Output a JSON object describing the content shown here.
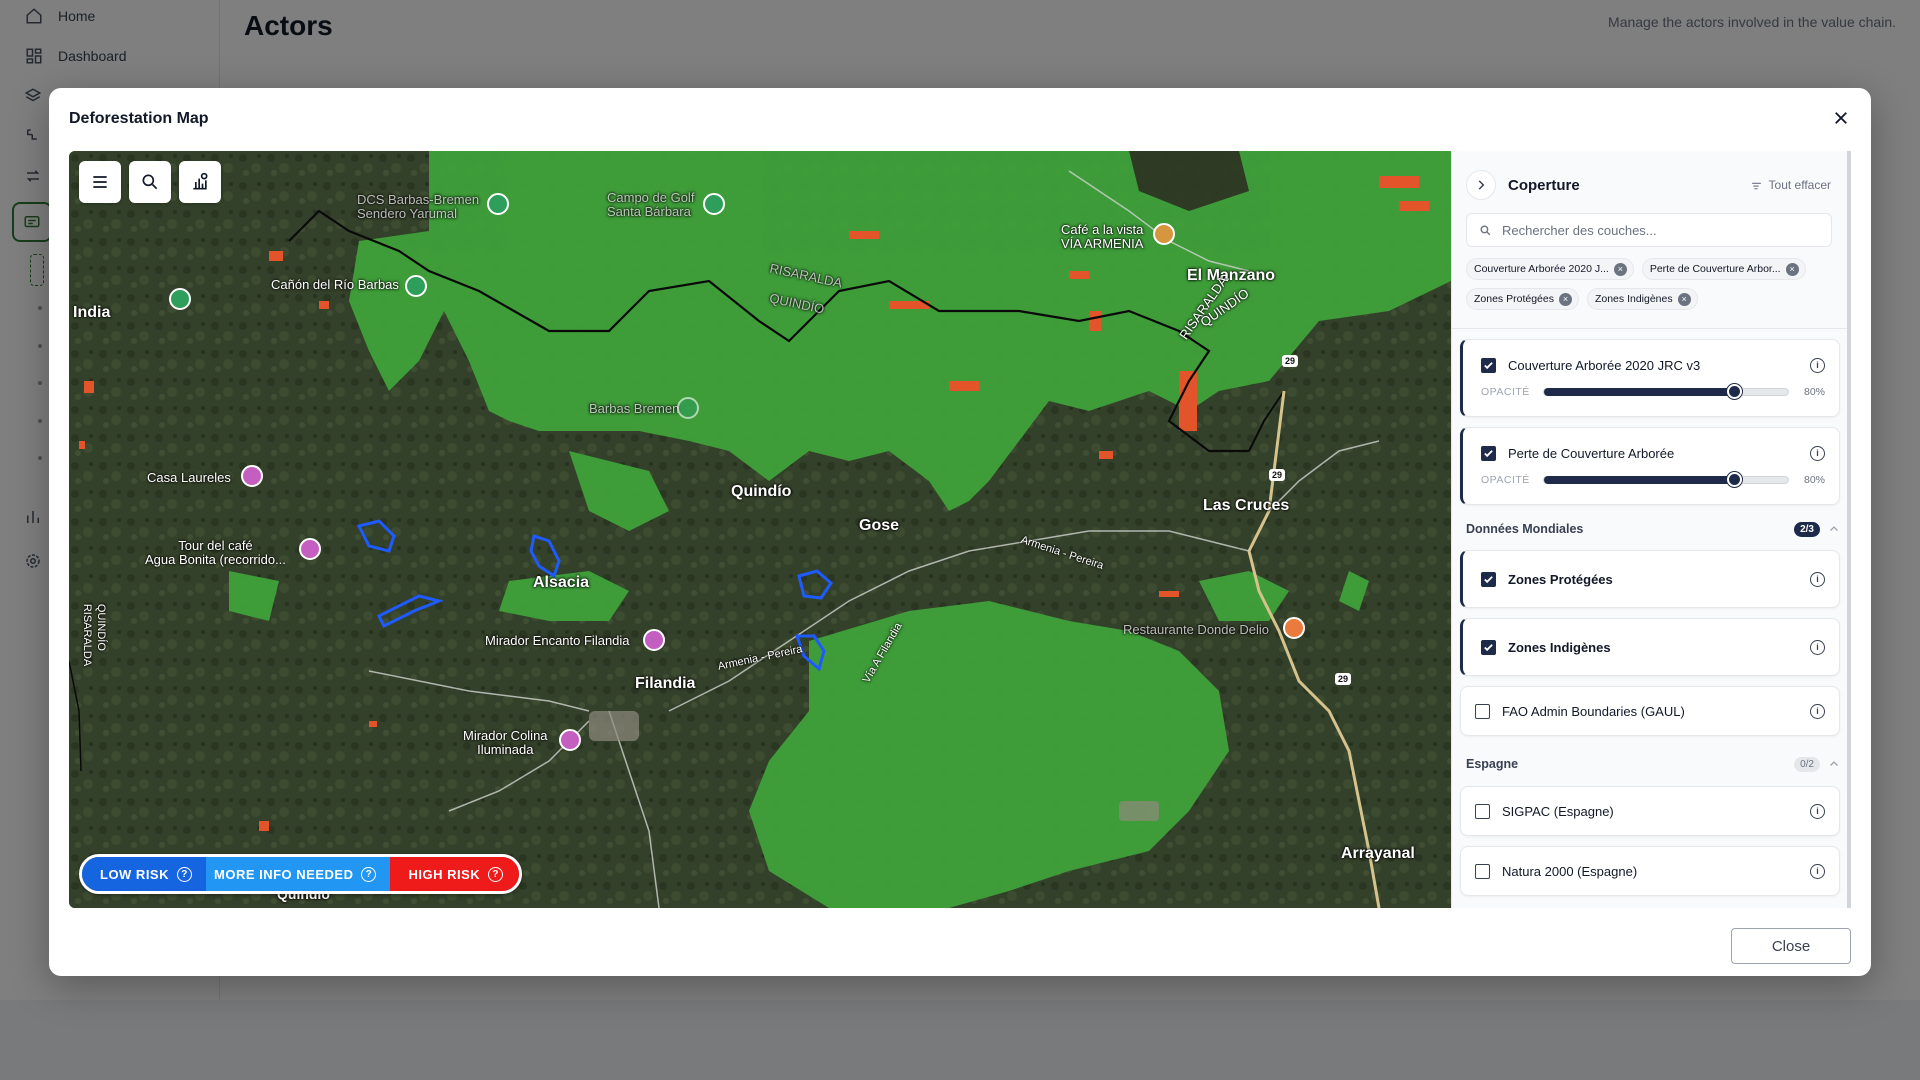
{
  "app": {
    "sidebar": {
      "items": [
        {
          "label": "Home",
          "icon": "home-icon"
        },
        {
          "label": "Dashboard",
          "icon": "dashboard-icon"
        }
      ]
    },
    "page_title": "Actors",
    "page_subtitle": "Manage the actors involved in the value chain."
  },
  "modal": {
    "title": "Deforestation Map",
    "close_label": "Close"
  },
  "map": {
    "places": [
      {
        "id": "dcs",
        "text": "DCS Barbas-Bremen\nSendero Yarumal",
        "dim": true
      },
      {
        "id": "campo",
        "text": "Campo de Golf\nSanta Bárbara",
        "dim": true
      },
      {
        "id": "cafe",
        "text": "Café a la vista\nVÍA ARMENIA",
        "dim": false
      },
      {
        "id": "manzano",
        "text": "El Manzano",
        "big": true
      },
      {
        "id": "canon",
        "text": "Cañón del Río Barbas",
        "dim": false
      },
      {
        "id": "india",
        "text": "India",
        "big": true
      },
      {
        "id": "risaralda1",
        "text": "RISARALDA",
        "dim": true
      },
      {
        "id": "quindio1",
        "text": "QUINDÍO",
        "dim": true
      },
      {
        "id": "risaralda2",
        "text": "RISARALDA",
        "dim": false
      },
      {
        "id": "quindio2",
        "text": "QUINDÍO",
        "dim": false
      },
      {
        "id": "barbas",
        "text": "Barbas Bremen",
        "dim": true
      },
      {
        "id": "laureles",
        "text": "Casa Laureles",
        "dim": false
      },
      {
        "id": "quindio3",
        "text": "Quindío",
        "big": true
      },
      {
        "id": "gose",
        "text": "Gose",
        "big": true
      },
      {
        "id": "cruces",
        "text": "Las Cruces",
        "big": true
      },
      {
        "id": "tour",
        "text": "Tour del café\nAgua Bonita (recorrido...",
        "dim": false
      },
      {
        "id": "alsacia",
        "text": "Alsacia",
        "big": true
      },
      {
        "id": "armenia1",
        "text": "Armenia - Pereira",
        "dim": false
      },
      {
        "id": "restaurante",
        "text": "Restaurante Donde Delio",
        "dim": true
      },
      {
        "id": "mirador1",
        "text": "Mirador Encanto Filandia",
        "dim": false
      },
      {
        "id": "vialf",
        "text": "Vía A Filandia",
        "dim": false
      },
      {
        "id": "filandia",
        "text": "Filandia",
        "big": true
      },
      {
        "id": "armenia2",
        "text": "Armenia - Pereira",
        "dim": false
      },
      {
        "id": "quindio4",
        "text": "QUINDÍO\nRISARALDA",
        "dim": false
      },
      {
        "id": "mirador2",
        "text": "Mirador Colina\nIluminada",
        "dim": false
      },
      {
        "id": "arrayanal",
        "text": "Arrayanal",
        "big": true
      },
      {
        "id": "quindio5",
        "text": "Quindío",
        "big": true
      }
    ],
    "road_shields": [
      "29",
      "29",
      "29"
    ],
    "legend": [
      {
        "label": "LOW RISK",
        "color": "#1565e0"
      },
      {
        "label": "MORE INFO NEEDED",
        "color": "#2196f3"
      },
      {
        "label": "HIGH RISK",
        "color": "#ef1b1b"
      }
    ]
  },
  "panel": {
    "title": "Coperture",
    "clear_label": "Tout effacer",
    "search_placeholder": "Rechercher des couches...",
    "chips": [
      "Couverture Arborée 2020 J...",
      "Perte de Couverture Arbor...",
      "Zones Protégées",
      "Zones Indigènes"
    ],
    "opacity_label": "OPACITÉ",
    "layers_top": [
      {
        "label": "Couverture Arborée 2020 JRC v3",
        "checked": true,
        "opacity": "80%"
      },
      {
        "label": "Perte de Couverture Arborée",
        "checked": true,
        "opacity": "80%"
      }
    ],
    "section_world": {
      "title": "Données Mondiales",
      "badge": "2/3"
    },
    "layers_world": [
      {
        "label": "Zones Protégées",
        "checked": true
      },
      {
        "label": "Zones Indigènes",
        "checked": true
      },
      {
        "label": "FAO Admin Boundaries (GAUL)",
        "checked": false
      }
    ],
    "section_spain": {
      "title": "Espagne",
      "badge": "0/2"
    },
    "layers_spain": [
      {
        "label": "SIGPAC (Espagne)",
        "checked": false
      },
      {
        "label": "Natura 2000 (Espagne)",
        "checked": false
      }
    ]
  }
}
